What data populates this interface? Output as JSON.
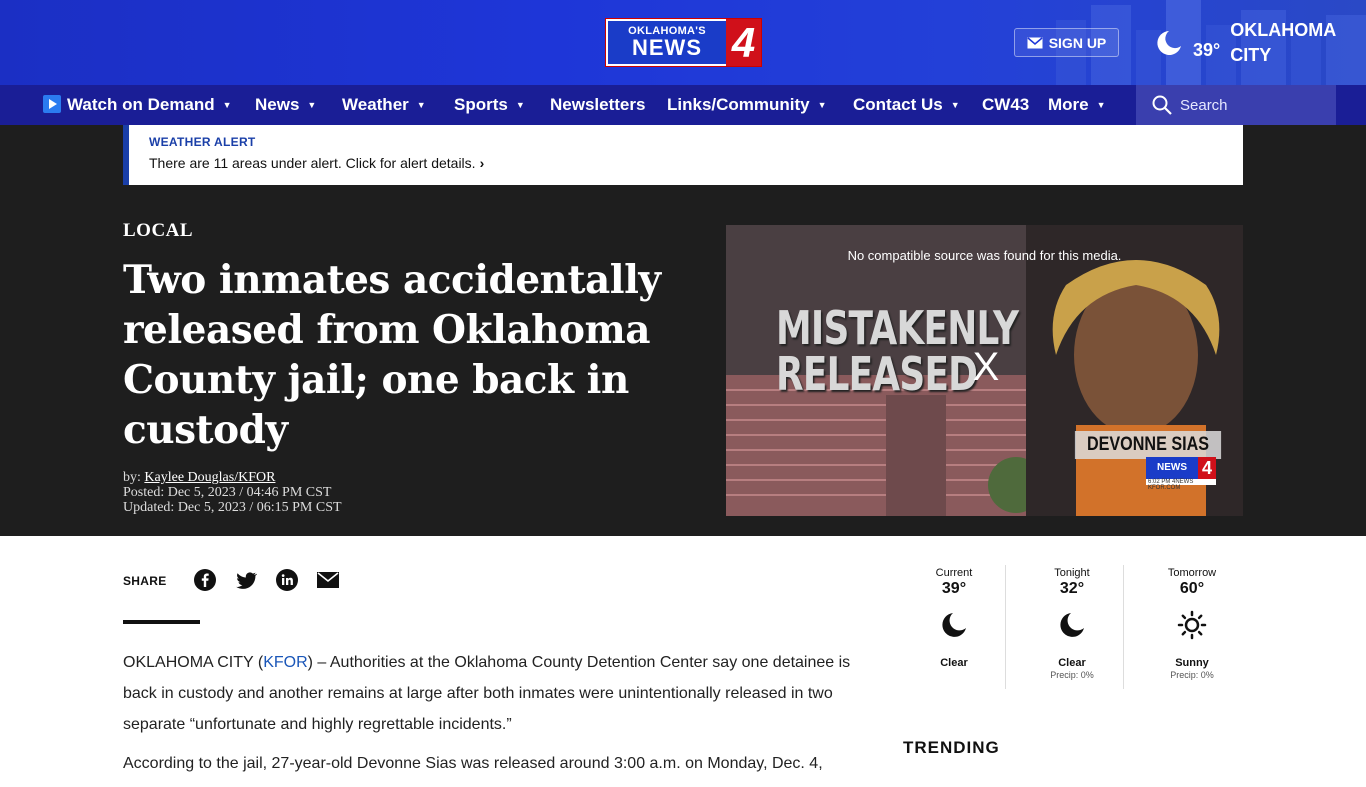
{
  "header": {
    "logo": {
      "top": "OKLAHOMA'S",
      "main": "NEWS",
      "number": "4"
    },
    "signup_label": "SIGN UP",
    "weather": {
      "temp": "39°",
      "city": "OKLAHOMA CITY",
      "icon": "moon-icon"
    },
    "colors": {
      "topbar": "#1e36d8",
      "nav": "#1a1e96",
      "accent_red": "#d0101a"
    }
  },
  "nav": {
    "items": [
      {
        "label": "Watch on Demand",
        "dropdown": true,
        "icon": "play-icon"
      },
      {
        "label": "News",
        "dropdown": true
      },
      {
        "label": "Weather",
        "dropdown": true
      },
      {
        "label": "Sports",
        "dropdown": true
      },
      {
        "label": "Newsletters",
        "dropdown": false
      },
      {
        "label": "Links/Community",
        "dropdown": true
      },
      {
        "label": "Contact Us",
        "dropdown": true
      },
      {
        "label": "CW43",
        "dropdown": false
      },
      {
        "label": "More",
        "dropdown": true
      }
    ],
    "search_placeholder": "Search"
  },
  "alert": {
    "title": "WEATHER ALERT",
    "detail": "There are 11 areas under alert. Click for alert details."
  },
  "article": {
    "category": "LOCAL",
    "headline": "Two inmates accidentally released from Oklahoma County jail; one back in custody",
    "byline_prefix": "by:",
    "author": "Kaylee Douglas/KFOR",
    "posted": "Posted: Dec 5, 2023 / 04:46 PM CST",
    "updated": "Updated: Dec 5, 2023 / 06:15 PM CST",
    "share_label": "SHARE",
    "share_icons": [
      "facebook-icon",
      "twitter-icon",
      "linkedin-icon",
      "email-icon"
    ],
    "body": {
      "p1_pre": "OKLAHOMA CITY (",
      "p1_link": "KFOR",
      "p1_post": ") – Authorities at the Oklahoma County Detention Center say one detainee is back in custody and another remains at large after both inmates were unintentionally released in two separate “unfortunate and highly regrettable incidents.”",
      "p2": "According to the jail, 27-year-old Devonne Sias was released around 3:00 a.m. on Monday, Dec. 4,"
    }
  },
  "video": {
    "message": "No compatible source was found for this media.",
    "overlay_line1": "MISTAKENLY",
    "overlay_line2": "RELEASED",
    "close": "X",
    "name_banner": "DEVONNE SIAS",
    "mini_logo": "NEWS",
    "mini_num": "4",
    "mini_sub": "6:02 PM   4NEWS KFOR.COM"
  },
  "forecast": [
    {
      "label": "Current",
      "temp": "39°",
      "icon": "moon-icon",
      "condition": "Clear",
      "precip": ""
    },
    {
      "label": "Tonight",
      "temp": "32°",
      "icon": "moon-icon",
      "condition": "Clear",
      "precip": "Precip: 0%"
    },
    {
      "label": "Tomorrow",
      "temp": "60°",
      "icon": "sun-icon",
      "condition": "Sunny",
      "precip": "Precip: 0%"
    }
  ],
  "trending_label": "TRENDING"
}
